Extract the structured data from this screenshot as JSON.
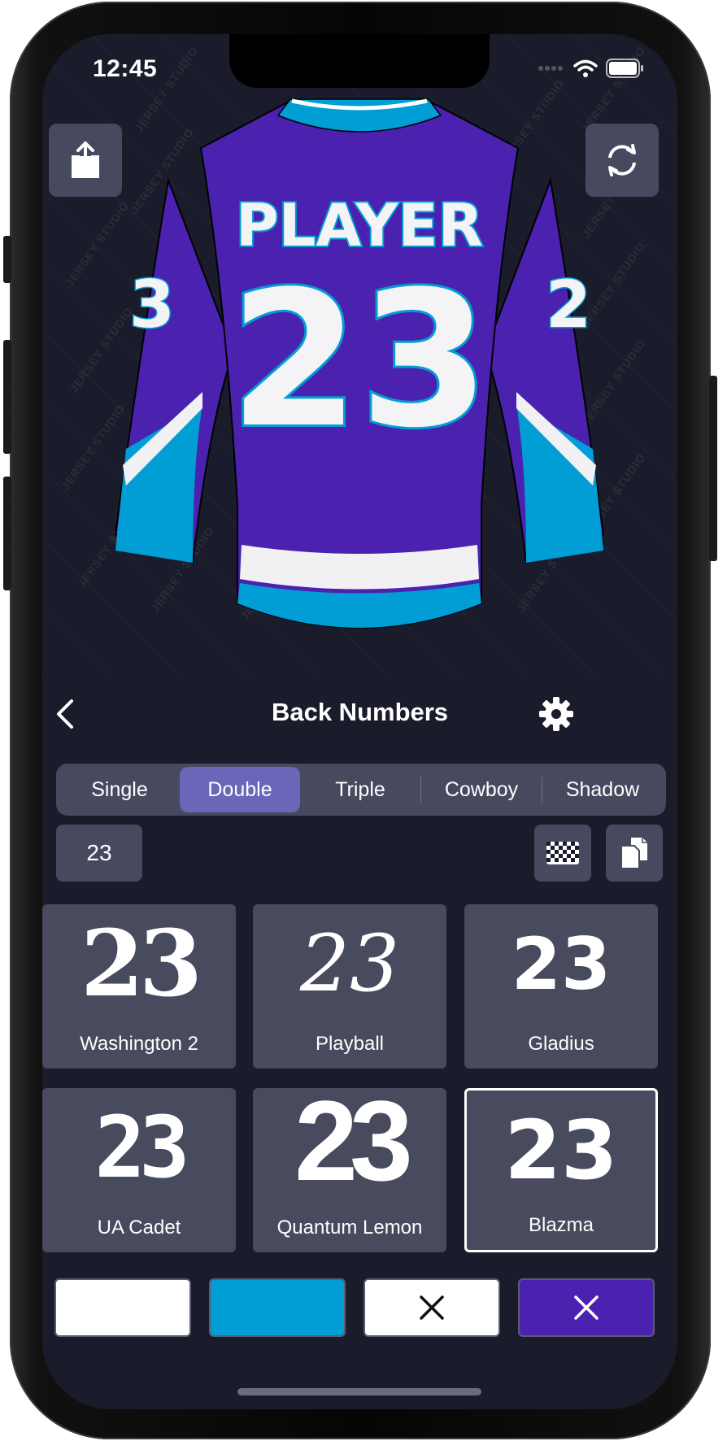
{
  "status_bar": {
    "time": "12:45"
  },
  "preview": {
    "watermark_text": "JERSEY STUDIO",
    "jersey": {
      "name": "PLAYER",
      "number": "23",
      "sleeve_left": "3",
      "sleeve_right": "2"
    },
    "share_icon": "share-icon",
    "rotate_icon": "rotate-icon"
  },
  "nav": {
    "title": "Back Numbers",
    "back_icon": "chevron-left-icon",
    "settings_icon": "gear-icon"
  },
  "segments": [
    {
      "label": "Single",
      "selected": false
    },
    {
      "label": "Double",
      "selected": true
    },
    {
      "label": "Triple",
      "selected": false
    },
    {
      "label": "Cowboy",
      "selected": false
    },
    {
      "label": "Shadow",
      "selected": false
    }
  ],
  "number_input": {
    "value": "23"
  },
  "fonts": [
    {
      "label": "Washington 2",
      "sample": "23",
      "selected": false
    },
    {
      "label": "Playball",
      "sample": "23",
      "selected": false
    },
    {
      "label": "Gladius",
      "sample": "23",
      "selected": false
    },
    {
      "label": "UA Cadet",
      "sample": "23",
      "selected": false
    },
    {
      "label": "Quantum Lemon",
      "sample": "23",
      "selected": false
    },
    {
      "label": "Blazma",
      "sample": "23",
      "selected": true
    }
  ],
  "colors": [
    {
      "hex": "#ffffff",
      "cleared": false
    },
    {
      "hex": "#009ed4",
      "cleared": false
    },
    {
      "hex": "#ffffff",
      "cleared": true
    },
    {
      "hex": "#4b22b0",
      "cleared": true
    }
  ],
  "theme": {
    "background": "#1a1c2b",
    "tile": "#484a5e",
    "segment_selected": "#6a66b8",
    "jersey_purple": "#4b22b0",
    "jersey_cyan": "#009ed4"
  }
}
